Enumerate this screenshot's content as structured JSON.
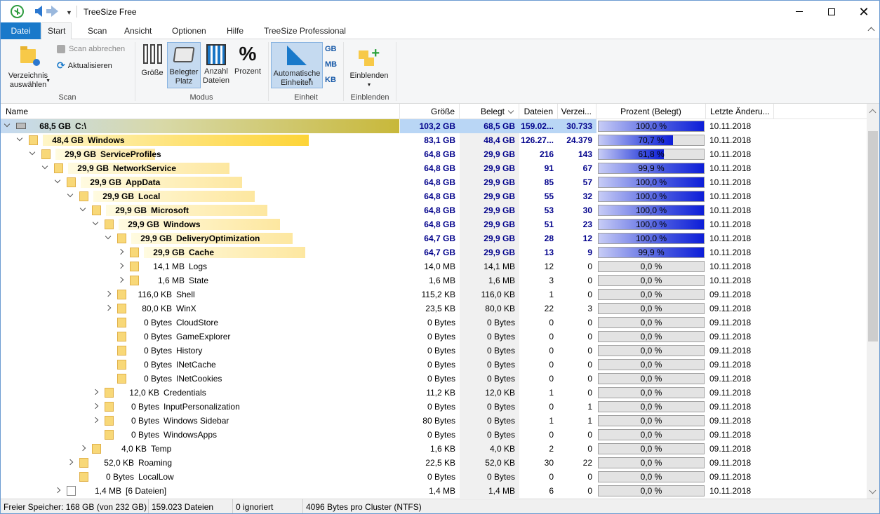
{
  "window": {
    "title": "TreeSize Free"
  },
  "tabs": [
    "Datei",
    "Start",
    "Scan",
    "Ansicht",
    "Optionen",
    "Hilfe",
    "TreeSize Professional"
  ],
  "ribbon": {
    "scan_group": {
      "label": "Scan",
      "select_dir": "Verzeichnis\nauswählen",
      "abort": "Scan abbrechen",
      "refresh": "Aktualisieren"
    },
    "mode_group": {
      "label": "Modus",
      "size": "Größe",
      "used": "Belegter\nPlatz",
      "count": "Anzahl\nDateien",
      "percent": "Prozent"
    },
    "unit_group": {
      "label": "Einheit",
      "auto": "Automatische\nEinheiten",
      "gb": "GB",
      "mb": "MB",
      "kb": "KB"
    },
    "show_group": {
      "label": "Einblenden",
      "show": "Einblenden"
    }
  },
  "columns": {
    "name": "Name",
    "size": "Größe",
    "used": "Belegt",
    "files": "Dateien",
    "folders": "Verzei...",
    "percent": "Prozent (Belegt)",
    "modified": "Letzte Änderu..."
  },
  "rows": [
    {
      "level": 0,
      "exp": "open",
      "icon": "drive",
      "size": "68,5 GB",
      "name": "C:\\",
      "grosse": "103,2 GB",
      "belegt": "68,5 GB",
      "dateien": "159.02...",
      "verz": "30.733",
      "pct": "100,0 %",
      "pval": 100,
      "date": "10.11.2018",
      "bar": 1.0,
      "bold": true,
      "selected": true
    },
    {
      "level": 1,
      "exp": "open",
      "icon": "folder",
      "size": "48,4 GB",
      "name": "Windows",
      "grosse": "83,1 GB",
      "belegt": "48,4 GB",
      "dateien": "126.27...",
      "verz": "24.379",
      "pct": "70,7 %",
      "pval": 70.7,
      "date": "10.11.2018",
      "bar": 0.707,
      "bold": true
    },
    {
      "level": 2,
      "exp": "open",
      "icon": "folder",
      "size": "29,9 GB",
      "name": "ServiceProfiles",
      "grosse": "64,8 GB",
      "belegt": "29,9 GB",
      "dateien": "216",
      "verz": "143",
      "pct": "61,8 %",
      "pval": 61.8,
      "date": "10.11.2018",
      "bar": 0.618,
      "bold": true
    },
    {
      "level": 3,
      "exp": "open",
      "icon": "folder",
      "size": "29,9 GB",
      "name": "NetworkService",
      "grosse": "64,8 GB",
      "belegt": "29,9 GB",
      "dateien": "91",
      "verz": "67",
      "pct": "99,9 %",
      "pval": 99.9,
      "date": "10.11.2018",
      "bar": 0.999,
      "bold": true
    },
    {
      "level": 4,
      "exp": "open",
      "icon": "folder",
      "size": "29,9 GB",
      "name": "AppData",
      "grosse": "64,8 GB",
      "belegt": "29,9 GB",
      "dateien": "85",
      "verz": "57",
      "pct": "100,0 %",
      "pval": 100,
      "date": "10.11.2018",
      "bar": 1.0,
      "bold": true
    },
    {
      "level": 5,
      "exp": "open",
      "icon": "folder",
      "size": "29,9 GB",
      "name": "Local",
      "grosse": "64,8 GB",
      "belegt": "29,9 GB",
      "dateien": "55",
      "verz": "32",
      "pct": "100,0 %",
      "pval": 100,
      "date": "10.11.2018",
      "bar": 1.0,
      "bold": true
    },
    {
      "level": 6,
      "exp": "open",
      "icon": "folder",
      "size": "29,9 GB",
      "name": "Microsoft",
      "grosse": "64,8 GB",
      "belegt": "29,9 GB",
      "dateien": "53",
      "verz": "30",
      "pct": "100,0 %",
      "pval": 100,
      "date": "10.11.2018",
      "bar": 1.0,
      "bold": true
    },
    {
      "level": 7,
      "exp": "open",
      "icon": "folder",
      "size": "29,9 GB",
      "name": "Windows",
      "grosse": "64,8 GB",
      "belegt": "29,9 GB",
      "dateien": "51",
      "verz": "23",
      "pct": "100,0 %",
      "pval": 100,
      "date": "10.11.2018",
      "bar": 1.0,
      "bold": true
    },
    {
      "level": 8,
      "exp": "open",
      "icon": "folder",
      "size": "29,9 GB",
      "name": "DeliveryOptimization",
      "grosse": "64,7 GB",
      "belegt": "29,9 GB",
      "dateien": "28",
      "verz": "12",
      "pct": "100,0 %",
      "pval": 100,
      "date": "10.11.2018",
      "bar": 1.0,
      "bold": true
    },
    {
      "level": 9,
      "exp": "closed",
      "icon": "folder",
      "size": "29,9 GB",
      "name": "Cache",
      "grosse": "64,7 GB",
      "belegt": "29,9 GB",
      "dateien": "13",
      "verz": "9",
      "pct": "99,9 %",
      "pval": 99.9,
      "date": "10.11.2018",
      "bar": 0.999,
      "bold": true
    },
    {
      "level": 9,
      "exp": "closed",
      "icon": "folder",
      "size": "14,1 MB",
      "name": "Logs",
      "grosse": "14,0 MB",
      "belegt": "14,1 MB",
      "dateien": "12",
      "verz": "0",
      "pct": "0,0 %",
      "pval": 0,
      "date": "10.11.2018",
      "bar": 0,
      "bold": false
    },
    {
      "level": 9,
      "exp": "closed",
      "icon": "folder",
      "size": "1,6 MB",
      "name": "State",
      "grosse": "1,6 MB",
      "belegt": "1,6 MB",
      "dateien": "3",
      "verz": "0",
      "pct": "0,0 %",
      "pval": 0,
      "date": "10.11.2018",
      "bar": 0,
      "bold": false
    },
    {
      "level": 8,
      "exp": "closed",
      "icon": "folder",
      "size": "116,0 KB",
      "name": "Shell",
      "grosse": "115,2 KB",
      "belegt": "116,0 KB",
      "dateien": "1",
      "verz": "0",
      "pct": "0,0 %",
      "pval": 0,
      "date": "09.11.2018",
      "bar": 0,
      "bold": false
    },
    {
      "level": 8,
      "exp": "closed",
      "icon": "folder",
      "size": "80,0 KB",
      "name": "WinX",
      "grosse": "23,5 KB",
      "belegt": "80,0 KB",
      "dateien": "22",
      "verz": "3",
      "pct": "0,0 %",
      "pval": 0,
      "date": "09.11.2018",
      "bar": 0,
      "bold": false
    },
    {
      "level": 8,
      "exp": "none",
      "icon": "folder",
      "size": "0 Bytes",
      "name": "CloudStore",
      "grosse": "0 Bytes",
      "belegt": "0 Bytes",
      "dateien": "0",
      "verz": "0",
      "pct": "0,0 %",
      "pval": 0,
      "date": "09.11.2018",
      "bar": 0,
      "bold": false
    },
    {
      "level": 8,
      "exp": "none",
      "icon": "folder",
      "size": "0 Bytes",
      "name": "GameExplorer",
      "grosse": "0 Bytes",
      "belegt": "0 Bytes",
      "dateien": "0",
      "verz": "0",
      "pct": "0,0 %",
      "pval": 0,
      "date": "09.11.2018",
      "bar": 0,
      "bold": false
    },
    {
      "level": 8,
      "exp": "none",
      "icon": "folder",
      "size": "0 Bytes",
      "name": "History",
      "grosse": "0 Bytes",
      "belegt": "0 Bytes",
      "dateien": "0",
      "verz": "0",
      "pct": "0,0 %",
      "pval": 0,
      "date": "09.11.2018",
      "bar": 0,
      "bold": false
    },
    {
      "level": 8,
      "exp": "none",
      "icon": "folder",
      "size": "0 Bytes",
      "name": "INetCache",
      "grosse": "0 Bytes",
      "belegt": "0 Bytes",
      "dateien": "0",
      "verz": "0",
      "pct": "0,0 %",
      "pval": 0,
      "date": "09.11.2018",
      "bar": 0,
      "bold": false
    },
    {
      "level": 8,
      "exp": "none",
      "icon": "folder",
      "size": "0 Bytes",
      "name": "INetCookies",
      "grosse": "0 Bytes",
      "belegt": "0 Bytes",
      "dateien": "0",
      "verz": "0",
      "pct": "0,0 %",
      "pval": 0,
      "date": "09.11.2018",
      "bar": 0,
      "bold": false
    },
    {
      "level": 7,
      "exp": "closed",
      "icon": "folder",
      "size": "12,0 KB",
      "name": "Credentials",
      "grosse": "11,2 KB",
      "belegt": "12,0 KB",
      "dateien": "1",
      "verz": "0",
      "pct": "0,0 %",
      "pval": 0,
      "date": "09.11.2018",
      "bar": 0,
      "bold": false
    },
    {
      "level": 7,
      "exp": "closed",
      "icon": "folder",
      "size": "0 Bytes",
      "name": "InputPersonalization",
      "grosse": "0 Bytes",
      "belegt": "0 Bytes",
      "dateien": "0",
      "verz": "1",
      "pct": "0,0 %",
      "pval": 0,
      "date": "09.11.2018",
      "bar": 0,
      "bold": false
    },
    {
      "level": 7,
      "exp": "closed",
      "icon": "folder",
      "size": "0 Bytes",
      "name": "Windows Sidebar",
      "grosse": "80 Bytes",
      "belegt": "0 Bytes",
      "dateien": "1",
      "verz": "1",
      "pct": "0,0 %",
      "pval": 0,
      "date": "09.11.2018",
      "bar": 0,
      "bold": false
    },
    {
      "level": 7,
      "exp": "none",
      "icon": "folder",
      "size": "0 Bytes",
      "name": "WindowsApps",
      "grosse": "0 Bytes",
      "belegt": "0 Bytes",
      "dateien": "0",
      "verz": "0",
      "pct": "0,0 %",
      "pval": 0,
      "date": "09.11.2018",
      "bar": 0,
      "bold": false
    },
    {
      "level": 6,
      "exp": "closed",
      "icon": "folder",
      "size": "4,0 KB",
      "name": "Temp",
      "grosse": "1,6 KB",
      "belegt": "4,0 KB",
      "dateien": "2",
      "verz": "0",
      "pct": "0,0 %",
      "pval": 0,
      "date": "09.11.2018",
      "bar": 0,
      "bold": false
    },
    {
      "level": 5,
      "exp": "closed",
      "icon": "folder",
      "size": "52,0 KB",
      "name": "Roaming",
      "grosse": "22,5 KB",
      "belegt": "52,0 KB",
      "dateien": "30",
      "verz": "22",
      "pct": "0,0 %",
      "pval": 0,
      "date": "09.11.2018",
      "bar": 0,
      "bold": false
    },
    {
      "level": 5,
      "exp": "none",
      "icon": "folder",
      "size": "0 Bytes",
      "name": "LocalLow",
      "grosse": "0 Bytes",
      "belegt": "0 Bytes",
      "dateien": "0",
      "verz": "0",
      "pct": "0,0 %",
      "pval": 0,
      "date": "09.11.2018",
      "bar": 0,
      "bold": false
    },
    {
      "level": 4,
      "exp": "closed",
      "icon": "file",
      "size": "1,4 MB",
      "name": "[6 Dateien]",
      "grosse": "1,4 MB",
      "belegt": "1,4 MB",
      "dateien": "6",
      "verz": "0",
      "pct": "0,0 %",
      "pval": 0,
      "date": "10.11.2018",
      "bar": 0,
      "bold": false
    }
  ],
  "status": {
    "free": "Freier Speicher: 168 GB  (von 232 GB)",
    "files": "159.023  Dateien",
    "ignored": "0 ignoriert",
    "cluster": "4096  Bytes pro Cluster (NTFS)"
  }
}
